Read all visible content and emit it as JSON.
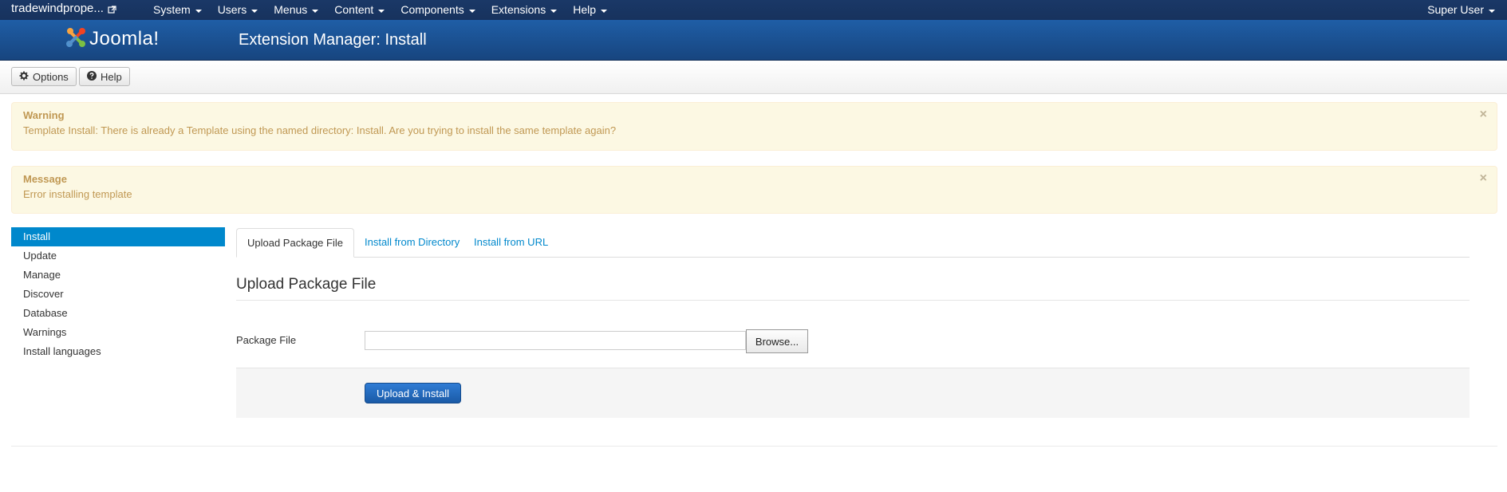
{
  "navbar": {
    "site_name": "tradewindprope...",
    "menus": [
      {
        "label": "System"
      },
      {
        "label": "Users"
      },
      {
        "label": "Menus"
      },
      {
        "label": "Content"
      },
      {
        "label": "Components"
      },
      {
        "label": "Extensions"
      },
      {
        "label": "Help"
      }
    ],
    "user": "Super User"
  },
  "header": {
    "logo_text": "Joomla!",
    "title": "Extension Manager: Install"
  },
  "toolbar": {
    "options_label": "Options",
    "help_label": "Help"
  },
  "alerts": {
    "warning": {
      "heading": "Warning",
      "text": "Template Install: There is already a Template using the named directory: Install. Are you trying to install the same template again?"
    },
    "message": {
      "heading": "Message",
      "text": "Error installing template"
    },
    "close_glyph": "×"
  },
  "sidebar": {
    "items": [
      {
        "label": "Install"
      },
      {
        "label": "Update"
      },
      {
        "label": "Manage"
      },
      {
        "label": "Discover"
      },
      {
        "label": "Database"
      },
      {
        "label": "Warnings"
      },
      {
        "label": "Install languages"
      }
    ]
  },
  "tabs": [
    {
      "label": "Upload Package File"
    },
    {
      "label": "Install from Directory"
    },
    {
      "label": "Install from URL"
    }
  ],
  "upload": {
    "section_title": "Upload Package File",
    "field_label": "Package File",
    "file_value": "",
    "browse_label": "Browse...",
    "submit_label": "Upload & Install"
  },
  "colors": {
    "navbar": "#17325d",
    "header": "#1b4f8f",
    "accent": "#0088cc",
    "alert_bg": "#fcf8e3",
    "alert_text": "#c09853",
    "primary_button": "#2068c0"
  }
}
